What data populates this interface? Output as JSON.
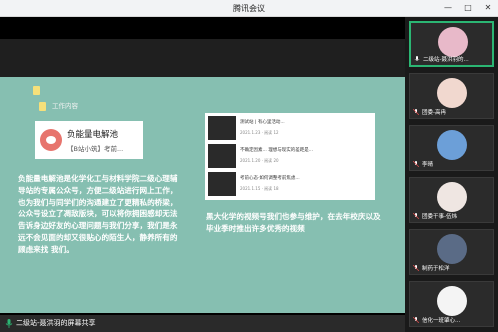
{
  "window": {
    "title": "腾讯会议",
    "minimize": "—",
    "maximize": "□",
    "close": "✕"
  },
  "slide": {
    "work_label": "工作内容",
    "logo_title": "负能量电解池",
    "logo_sub": "【B站小筑】考前...",
    "left_text": "负能量电解池是化学化工与材料学院二级心理辅导站的专属公众号，方便二级站进行网上工作，也为我们与同学们的沟通建立了更精私的桥梁，公众号设立了凋敌版块，可以将你拥困感却无法告诉身边好友的心理问题与我们分享，我们是永远不会见面的却又很贴心的陌生人，静养所有的顾虑来找 我们。",
    "feed": [
      {
        "line": "测试站 | 有心里活动...",
        "meta": "2021.1.23 · 阅读 12"
      },
      {
        "line": "不确定因素... 理想与现实的差距是...",
        "meta": "2021.1.20 · 阅读 20"
      },
      {
        "line": "考前心态·如何调整考前焦虑...",
        "meta": "2021.1.15 · 阅读 18"
      }
    ],
    "right_text": "黑大化学的视频号我们也参与维护，在去年校庆以及毕业季时推出许多优秀的视频"
  },
  "bottom": {
    "presenter": "二级站-聂洪羽的屏幕共享"
  },
  "participants": [
    {
      "name": "二级站-聂洪羽的...",
      "active": true,
      "avatar_color": "#e8b9c9"
    },
    {
      "name": "团委-高冉",
      "active": false,
      "avatar_color": "#f1d8cf"
    },
    {
      "name": "李晴",
      "active": false,
      "avatar_color": "#6c9fd8"
    },
    {
      "name": "团委干事-伍炜",
      "active": false,
      "avatar_color": "#efe6e2"
    },
    {
      "name": "制药于松洋",
      "active": false,
      "avatar_color": "#5a6b86"
    },
    {
      "name": "信化一班肇心...",
      "active": false,
      "avatar_color": "#f4f4f4"
    }
  ],
  "colors": {
    "slide_bg": "#86bfb1",
    "active_border": "#2bb673"
  }
}
